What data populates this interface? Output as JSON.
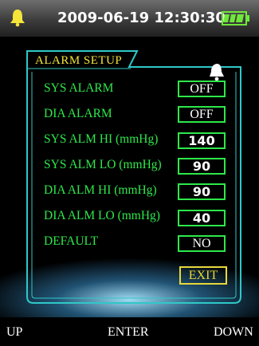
{
  "status_bar": {
    "datetime": "2009-06-19  12:30:30",
    "alarm_icon": "bell-icon",
    "battery_icon": "battery-full-icon",
    "accent_color": "#f5e43a"
  },
  "panel": {
    "title": "ALARM SETUP",
    "title_icon": "bell-icon",
    "items": [
      {
        "label": "SYS ALARM",
        "value": "OFF"
      },
      {
        "label": "DIA ALARM",
        "value": "OFF"
      },
      {
        "label": "SYS ALM HI (mmHg)",
        "value": "140"
      },
      {
        "label": "SYS ALM LO (mmHg)",
        "value": "90"
      },
      {
        "label": "DIA ALM HI (mmHg)",
        "value": "90"
      },
      {
        "label": "DIA ALM LO (mmHg)",
        "value": "40"
      },
      {
        "label": "DEFAULT",
        "value": "NO"
      }
    ],
    "exit_label": "EXIT",
    "label_color": "#2ee84a",
    "frame_color": "#2fc8c8"
  },
  "soft_keys": {
    "left": "UP",
    "center": "ENTER",
    "right": "DOWN"
  }
}
